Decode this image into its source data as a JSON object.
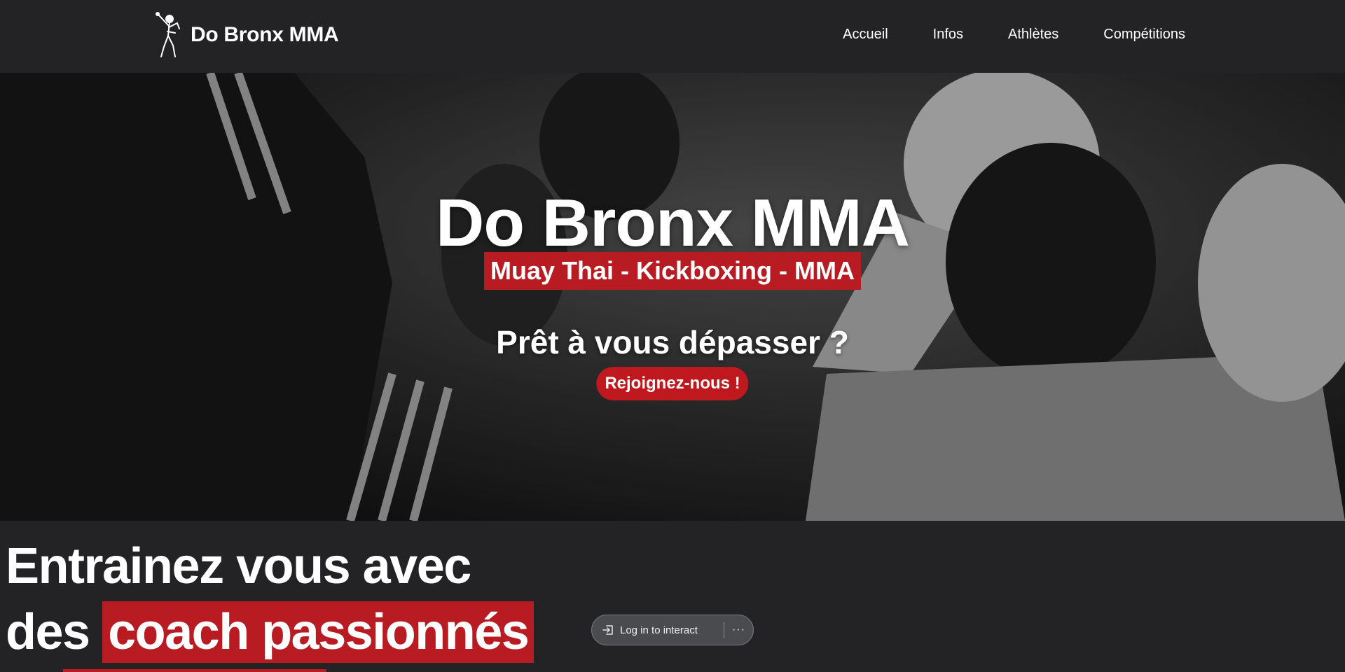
{
  "header": {
    "brand_name": "Do Bronx MMA",
    "nav": [
      {
        "label": "Accueil"
      },
      {
        "label": "Infos"
      },
      {
        "label": "Athlètes"
      },
      {
        "label": "Compétitions"
      }
    ]
  },
  "hero": {
    "title": "Do Bronx MMA",
    "subtitle": "Muay Thai - Kickboxing - MMA",
    "question": "Prêt à vous dépasser ?",
    "cta_label": "Rejoignez-nous !"
  },
  "coach_section": {
    "line1": "Entrainez vous avec",
    "line2_prefix": "des",
    "line2_highlight": "coach passionnés"
  },
  "overlay": {
    "login_label": "Log in to interact",
    "more_label": "···"
  },
  "colors": {
    "background": "#232325",
    "accent_red": "#b81c22",
    "text": "#ffffff"
  },
  "icons": {
    "brand_logo": "fighter-logo-icon",
    "login": "login-arrow-icon",
    "more": "more-dots-icon"
  }
}
